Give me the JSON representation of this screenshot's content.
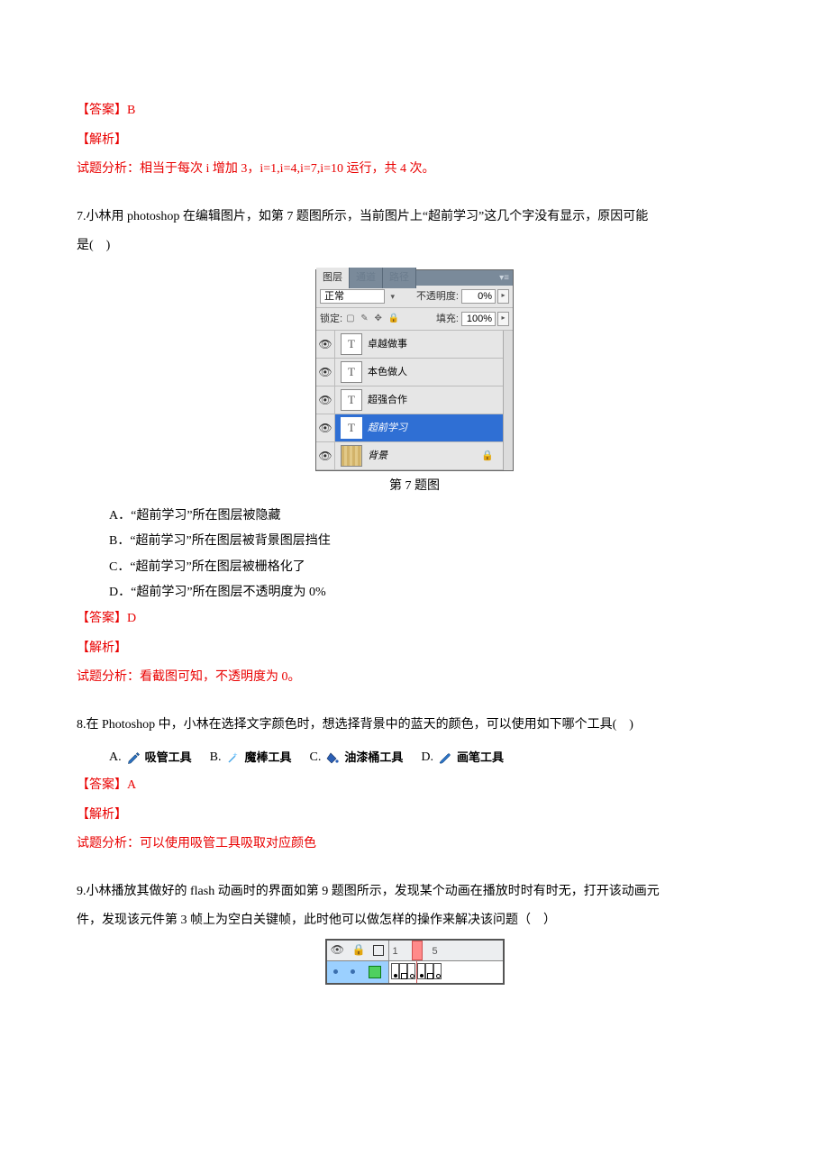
{
  "q6": {
    "answer_label": "【答案】B",
    "analysis_label": "【解析】",
    "analysis_text": "试题分析：相当于每次 i 增加 3，i=1,i=4,i=7,i=10 运行，共 4 次。"
  },
  "q7": {
    "stem_a": "7.小林用 photoshop 在编辑图片，如第 7 题图所示，当前图片上“超前学习”这几个字没有显示，原因可能",
    "stem_b": "是(　)",
    "caption": "第 7 题图",
    "opts": {
      "A": "A．“超前学习”所在图层被隐藏",
      "B": "B．“超前学习”所在图层被背景图层挡住",
      "C": "C．“超前学习”所在图层被栅格化了",
      "D": "D．“超前学习”所在图层不透明度为 0%"
    },
    "answer_label": "【答案】D",
    "analysis_label": "【解析】",
    "analysis_text": "试题分析：看截图可知，不透明度为 0。",
    "panel": {
      "tabs": {
        "layers": "图层",
        "channels": "通道",
        "paths": "路径"
      },
      "blend": "正常",
      "opacity_label": "不透明度:",
      "opacity_value": "0%",
      "lock_label": "锁定:",
      "fill_label": "填充:",
      "fill_value": "100%",
      "layers": [
        {
          "name": "卓越做事",
          "type": "T"
        },
        {
          "name": "本色做人",
          "type": "T"
        },
        {
          "name": "超强合作",
          "type": "T"
        },
        {
          "name": "超前学习",
          "type": "T",
          "selected": true
        },
        {
          "name": "背景",
          "type": "bg",
          "locked": true
        }
      ]
    }
  },
  "q8": {
    "stem": "8.在 Photoshop 中，小林在选择文字颜色时，想选择背景中的蓝天的颜色，可以使用如下哪个工具(　)",
    "opts": {
      "A": {
        "letter": "A.",
        "name": "吸管工具"
      },
      "B": {
        "letter": "B.",
        "name": "魔棒工具"
      },
      "C": {
        "letter": "C.",
        "name": "油漆桶工具"
      },
      "D": {
        "letter": "D.",
        "name": "画笔工具"
      }
    },
    "answer_label": "【答案】A",
    "analysis_label": "【解析】",
    "analysis_text": "试题分析：可以使用吸管工具吸取对应颜色"
  },
  "q9": {
    "stem_a": "9.小林播放其做好的 flash 动画时的界面如第 9 题图所示，发现某个动画在播放时时有时无，打开该动画元",
    "stem_b": "件，发现该元件第 3 帧上为空白关键帧，此时他可以做怎样的操作来解决该问题（　）",
    "frame_numbers": {
      "one": "1",
      "five": "5"
    }
  }
}
